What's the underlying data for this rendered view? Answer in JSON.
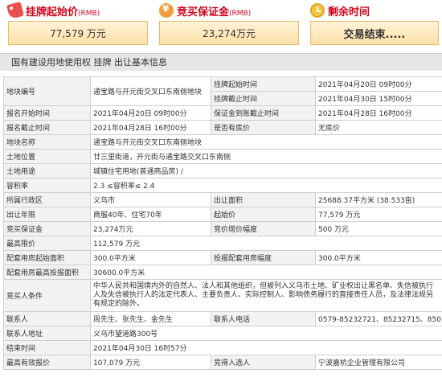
{
  "top": {
    "start_price": {
      "label": "挂牌起始价",
      "unit_label": "(RMB)",
      "value": "77,579 万元"
    },
    "deposit": {
      "label": "竞买保证金",
      "unit_label": "(RMB)",
      "value": "23,274万元"
    },
    "remaining": {
      "label": "剩余时间",
      "value": "交易结束....."
    }
  },
  "section_title": "国有建设用地使用权 挂牌 出让基本信息",
  "rows": {
    "plot_no": {
      "label": "地块编号",
      "value": "通宝路与开元街交叉口东南侧地块"
    },
    "listing_start": {
      "label": "挂牌起始时间",
      "value": "2021年04月20日 09时00分"
    },
    "listing_end": {
      "label": "挂牌截止时间",
      "value": "2021年04月30日 15时00分"
    },
    "reg_start": {
      "label": "报名开始时间",
      "value": "2021年04月20日 09时00分"
    },
    "deposit_deadline": {
      "label": "保证金到账截止时间",
      "value": "2021年04月28日 16时00分"
    },
    "reg_end": {
      "label": "报名截止时间",
      "value": "2021年04月28日 16时00分"
    },
    "has_reserve": {
      "label": "是否有底价",
      "value": "无底价"
    },
    "plot_name": {
      "label": "地块名称",
      "value": "通宝路与开元街交叉口东南侧地块"
    },
    "location": {
      "label": "土地位置",
      "value": "廿三里街道，开元街与通宝路交叉口东南侧"
    },
    "usage": {
      "label": "土地用途",
      "value": "城镇住宅用地(普通商品房) /"
    },
    "far": {
      "label": "容积率",
      "value": "2.3 ≤容积率≤ 2.4"
    },
    "district": {
      "label": "所属行政区",
      "value": "义乌市"
    },
    "area": {
      "label": "出让面积",
      "value": "25688.37平方米 (38.533亩)"
    },
    "term": {
      "label": "出让年限",
      "value": "商服40年、住宅70年"
    },
    "start_price": {
      "label": "起始价",
      "value": "77,579 万元"
    },
    "deposit": {
      "label": "竞买保证金",
      "value": "23,274万元"
    },
    "increment": {
      "label": "竞价增价幅度",
      "value": "500 万元"
    },
    "max_price": {
      "label": "最高限价",
      "value": "112,579 万元"
    },
    "supp_area": {
      "label": "配套用房起始面积",
      "value": "300.0平方米"
    },
    "supp_increment": {
      "label": "投报配套用房幅度",
      "value": "300.0平方米"
    },
    "supp_max": {
      "label": "配套用房最高投报面积",
      "value": "30600.0平方米"
    },
    "conditions": {
      "label": "竞买人条件",
      "value": "中华人民共和国境内外的自然人、法人和其他组织，但被列入义乌市土地、矿业权出让黑名单、失信被执行人及失信被执行人的法定代表人、主要负责人、实际控制人、影响债务履行的直接责任人员，及法律法规另有规定的除外。"
    },
    "contact": {
      "label": "联系人",
      "value": "周先生、张先生、金先生"
    },
    "phone": {
      "label": "联系人电话",
      "value": "0579-85232721、85232715、85016085"
    },
    "address": {
      "label": "联系人地址",
      "value": "义乌市望道路300号"
    },
    "end_time": {
      "label": "结束时间",
      "value": "2021年04月30日 16时57分"
    },
    "max_bid": {
      "label": "最高有效报价",
      "value": "107,079 万元"
    },
    "winner": {
      "label": "竞得入选人",
      "value": "宁波嘉杭企业管理有限公司"
    }
  }
}
